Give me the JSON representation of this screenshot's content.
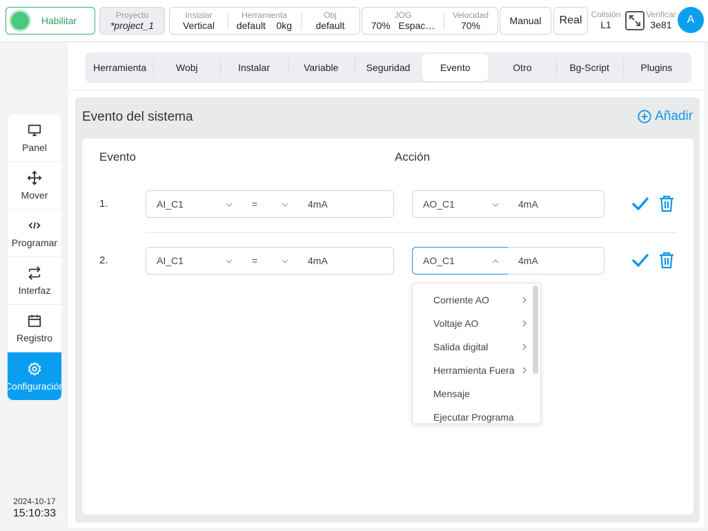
{
  "topbar": {
    "enable_label": "Habilitar",
    "project": {
      "caption": "Proyecto",
      "value": "*project_1"
    },
    "install_group": [
      {
        "caption": "Instalar",
        "value": "Vertical"
      },
      {
        "caption": "Herramienta",
        "value": "default    0kg"
      },
      {
        "caption": "Obj",
        "value": "default"
      }
    ],
    "jog_group": [
      {
        "caption": "JOG",
        "value": "70%   Espac…"
      },
      {
        "caption": "Velocidad",
        "value": "70%"
      }
    ],
    "manual_label": "Manual",
    "real_label": "Real",
    "colision": {
      "caption": "Colisión",
      "value": "L1"
    },
    "verificar": {
      "caption": "Verificar",
      "value": "3e81"
    },
    "avatar_letter": "A"
  },
  "sidebar": {
    "items": [
      {
        "label": "Panel",
        "icon": "monitor-icon"
      },
      {
        "label": "Mover",
        "icon": "move-arrows-icon"
      },
      {
        "label": "Programar",
        "icon": "code-icon"
      },
      {
        "label": "Interfaz",
        "icon": "swap-arrows-icon"
      },
      {
        "label": "Registro",
        "icon": "calendar-icon"
      },
      {
        "label": "Configuración",
        "icon": "gear-icon",
        "active": true
      }
    ],
    "date": "2024-10-17",
    "time": "15:10:33"
  },
  "tabs": [
    "Herramienta",
    "Wobj",
    "Instalar",
    "Variable",
    "Seguridad",
    "Evento",
    "Otro",
    "Bg-Script",
    "Plugins"
  ],
  "active_tab": "Evento",
  "panel": {
    "title": "Evento del sistema",
    "add_label": "Añadir",
    "col_event": "Evento",
    "col_action": "Acción",
    "rows": [
      {
        "num": "1.",
        "event_source": "AI_C1",
        "operator": "=",
        "event_value": "4mA",
        "action_target": "AO_C1",
        "action_value": "4mA"
      },
      {
        "num": "2.",
        "event_source": "AI_C1",
        "operator": "=",
        "event_value": "4mA",
        "action_target": "AO_C1",
        "action_value": "4mA"
      }
    ]
  },
  "dropdown": {
    "items": [
      {
        "label": "Corriente AO",
        "submenu": true
      },
      {
        "label": "Voltaje AO",
        "submenu": true
      },
      {
        "label": "Salida digital",
        "submenu": true
      },
      {
        "label": "Herramienta Fuera",
        "submenu": true
      },
      {
        "label": "Mensaje",
        "submenu": false
      },
      {
        "label": "Ejecutar Programa",
        "submenu": false
      }
    ]
  },
  "colors": {
    "accent": "#0a9ef0",
    "enable_green": "#4cc97e",
    "action_blue": "#1296e8"
  }
}
